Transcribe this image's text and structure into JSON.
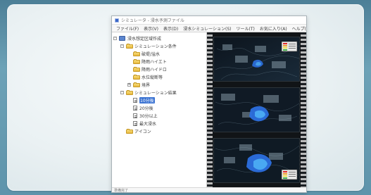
{
  "window": {
    "title": "シミュレータ - 浸水予測ファイル"
  },
  "menu": [
    "ファイル(F)",
    "表示(V)",
    "表示(D)",
    "浸水シミュレーション(S)",
    "ツール(T)",
    "お気に入り(A)",
    "ヘルプ(H)"
  ],
  "tree": [
    {
      "label": "浸水想定区域作成",
      "level": 0,
      "icon": "root-icon",
      "expander": "-"
    },
    {
      "label": "シミュレーション条件",
      "level": 1,
      "icon": "folder-icon",
      "expander": "-"
    },
    {
      "label": "破堤/溢水",
      "level": 2,
      "icon": "folder-icon"
    },
    {
      "label": "降雨ハイエト",
      "level": 2,
      "icon": "folder-icon"
    },
    {
      "label": "降雨ハイドロ",
      "level": 2,
      "icon": "folder-icon"
    },
    {
      "label": "水位縦断等",
      "level": 2,
      "icon": "folder-icon"
    },
    {
      "label": "境界",
      "level": 2,
      "icon": "folder-icon",
      "expander": "+"
    },
    {
      "label": "シミュレーション結果",
      "level": 1,
      "icon": "folder-icon",
      "expander": "-"
    },
    {
      "label": "10分後",
      "level": 2,
      "icon": "doc-icon",
      "selected": true
    },
    {
      "label": "20分後",
      "level": 2,
      "icon": "doc-icon"
    },
    {
      "label": "30分以上",
      "level": 2,
      "icon": "doc-icon"
    },
    {
      "label": "最大浸水",
      "level": 2,
      "icon": "doc-icon"
    },
    {
      "label": "アイコン",
      "level": 1,
      "icon": "folder-icon"
    }
  ],
  "status": {
    "text": "準備完了"
  }
}
